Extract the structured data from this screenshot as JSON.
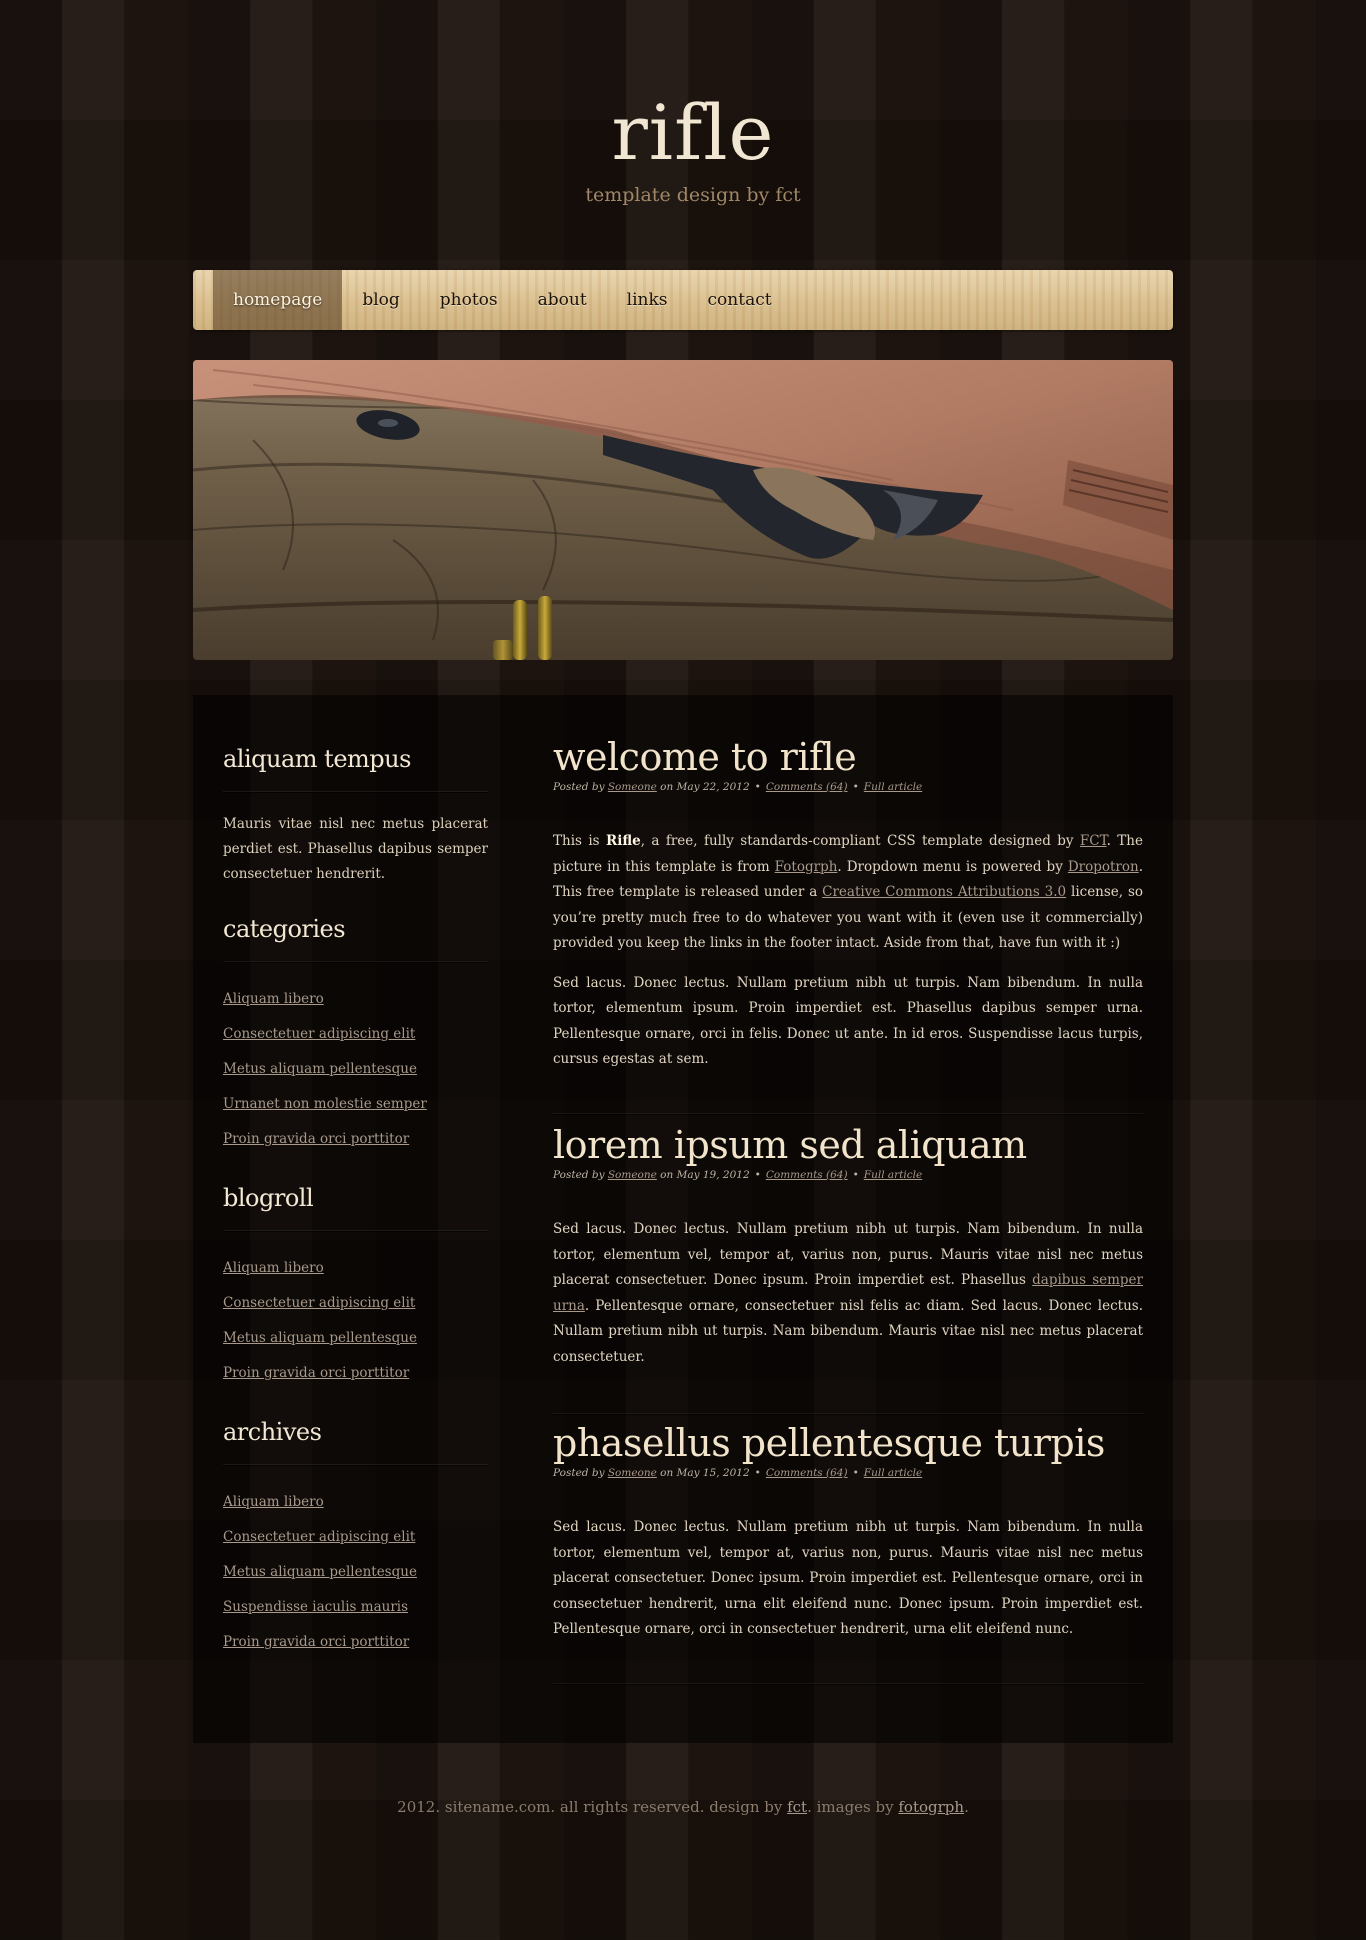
{
  "site": {
    "title": "rifle",
    "subtitle": "template design by fct"
  },
  "nav": {
    "items": [
      {
        "label": "homepage",
        "active": true
      },
      {
        "label": "blog"
      },
      {
        "label": "photos"
      },
      {
        "label": "about"
      },
      {
        "label": "links"
      },
      {
        "label": "contact"
      }
    ]
  },
  "sidebar": {
    "about": {
      "heading": "aliquam tempus",
      "text": "Mauris vitae nisl nec metus placerat perdiet est. Phasellus dapibus semper consectetuer hendrerit."
    },
    "categories": {
      "heading": "categories",
      "links": [
        "Aliquam libero",
        "Consectetuer adipiscing elit",
        "Metus aliquam pellentesque",
        "Urnanet non molestie semper",
        "Proin gravida orci porttitor"
      ]
    },
    "blogroll": {
      "heading": "blogroll",
      "links": [
        "Aliquam libero",
        "Consectetuer adipiscing elit",
        "Metus aliquam pellentesque",
        "Proin gravida orci porttitor"
      ]
    },
    "archives": {
      "heading": "archives",
      "links": [
        "Aliquam libero",
        "Consectetuer adipiscing elit",
        "Metus aliquam pellentesque",
        "Suspendisse iaculis mauris",
        "Proin gravida orci porttitor"
      ]
    }
  },
  "posts": [
    {
      "title": "welcome to rifle",
      "meta": {
        "posted_by": "Posted by",
        "author": "Someone",
        "date": "on May 22, 2012",
        "comments": "Comments (64)",
        "full": "Full article"
      },
      "p1": {
        "a": "This is ",
        "b": "Rifle",
        "c": ", a free, fully standards-compliant CSS template designed by ",
        "link1": "FCT",
        "d": ". The picture in this template is from ",
        "link2": "Fotogrph",
        "e": ". Dropdown menu is powered by ",
        "link3": "Dropotron",
        "f": ". This free template is released under a ",
        "link4": "Creative Commons Attributions 3.0",
        "g": " license, so you’re pretty much free to do whatever you want with it (even use it commercially) provided you keep the links in the footer intact. Aside from that, have fun with it :)"
      },
      "p2": "Sed lacus. Donec lectus. Nullam pretium nibh ut turpis. Nam bibendum. In nulla tortor, elementum ipsum. Proin imperdiet est. Phasellus dapibus semper urna. Pellentesque ornare, orci in felis. Donec ut ante. In id eros. Suspendisse lacus turpis, cursus egestas at sem."
    },
    {
      "title": "lorem ipsum sed aliquam",
      "meta": {
        "posted_by": "Posted by",
        "author": "Someone",
        "date": "on May 19, 2012",
        "comments": "Comments (64)",
        "full": "Full article"
      },
      "p1": {
        "a": "Sed lacus. Donec lectus. Nullam pretium nibh ut turpis. Nam bibendum. In nulla tortor, elementum vel, tempor at, varius non, purus. Mauris vitae nisl nec metus placerat consectetuer. Donec ipsum. Proin imperdiet est. Phasellus ",
        "link1": "dapibus semper urna",
        "b": ". Pellentesque ornare, consectetuer nisl felis ac diam. Sed lacus. Donec lectus. Nullam pretium nibh ut turpis. Nam bibendum. Mauris vitae nisl nec metus placerat consectetuer."
      }
    },
    {
      "title": "phasellus pellentesque turpis",
      "meta": {
        "posted_by": "Posted by",
        "author": "Someone",
        "date": "on May 15, 2012",
        "comments": "Comments (64)",
        "full": "Full article"
      },
      "p1": "Sed lacus. Donec lectus. Nullam pretium nibh ut turpis. Nam bibendum. In nulla tortor, elementum vel, tempor at, varius non, purus. Mauris vitae nisl nec metus placerat consectetuer. Donec ipsum. Proin imperdiet est. Pellentesque ornare, orci in consectetuer hendrerit, urna elit eleifend nunc. Donec ipsum. Proin imperdiet est. Pellentesque ornare, orci in consectetuer hendrerit, urna elit eleifend nunc."
    }
  ],
  "footer": {
    "a": "2012. sitename.com. all rights reserved. design by ",
    "link1": "fct",
    "b": ". images by ",
    "link2": "fotogrph",
    "c": "."
  }
}
